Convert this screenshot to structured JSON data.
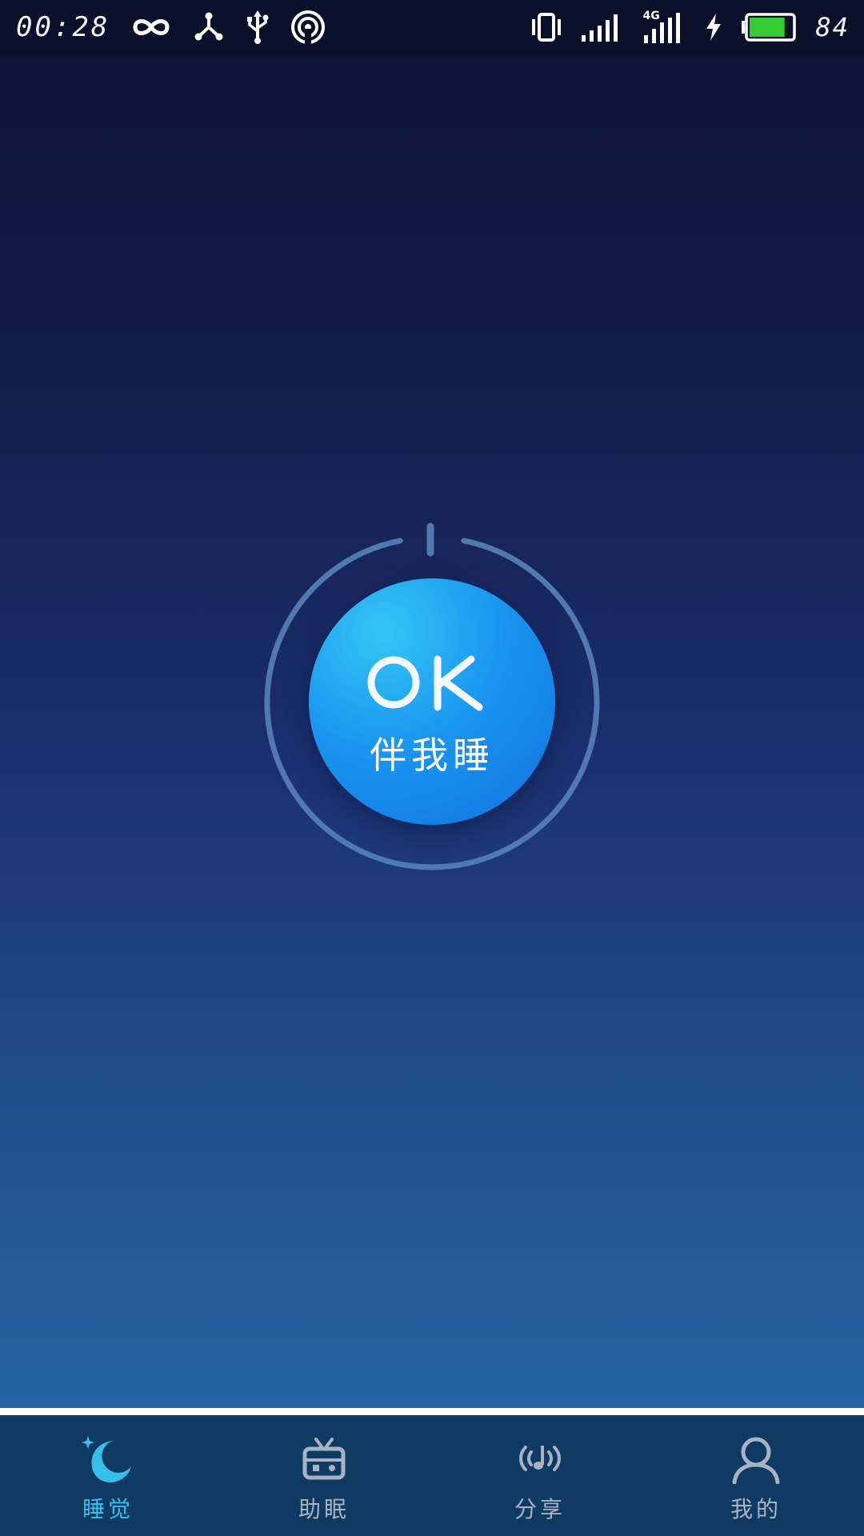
{
  "status_bar": {
    "time": "00:28",
    "battery_level": "84",
    "network_type": "4G",
    "left_icons": [
      "infinity-icon",
      "share-hub-icon",
      "usb-icon",
      "hotspot-icon"
    ],
    "right_icons": [
      "vibrate-icon",
      "signal-icon",
      "signal-4g-icon",
      "charging-icon",
      "battery-icon"
    ],
    "battery_fill_fraction": 0.84,
    "battery_color": "#33cc33"
  },
  "main": {
    "button_title": "OK",
    "button_caption": "伴我睡",
    "button_color": "#1a96f0",
    "ring_color": "#4f79b0"
  },
  "tabs": [
    {
      "label": "睡觉",
      "icon": "moon-stars-icon",
      "active": true
    },
    {
      "label": "助眠",
      "icon": "radio-icon",
      "active": false
    },
    {
      "label": "分享",
      "icon": "broadcast-music-icon",
      "active": false
    },
    {
      "label": "我的",
      "icon": "user-icon",
      "active": false
    }
  ],
  "colors": {
    "active_tab": "#35c0ec",
    "inactive_tab": "#a7b3c2",
    "tab_bar_bg": "#0f3a62"
  }
}
